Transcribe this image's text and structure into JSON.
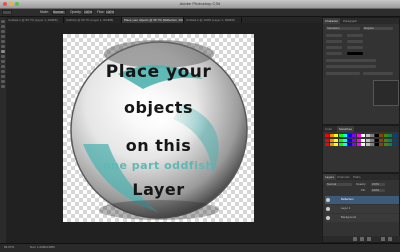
{
  "window": {
    "title": "Adobe Photoshop CS6"
  },
  "options_bar": {
    "tool": "Brush",
    "mode_label": "Mode:",
    "mode_value": "Normal",
    "opacity_label": "Opacity:",
    "opacity_value": "100%",
    "flow_label": "Flow:",
    "flow_value": "100%"
  },
  "tabs": [
    {
      "label": "Untitled-1 @ 66.7% (Layer 1, RGB/8)"
    },
    {
      "label": "SoftClip @ 66.7% (Layer 1, RGB/8)"
    },
    {
      "label": "Place your objects @ 66.7% (Reflection, RGB/8)"
    },
    {
      "label": "Untitled-2 @ 100% (Layer 1, RGB/8)"
    }
  ],
  "canvas_text": {
    "line1": "Place your",
    "line2": "objects",
    "line3": "on this",
    "line4": "one part oddfish",
    "line5": "Layer"
  },
  "panels": {
    "character": {
      "tabs": [
        "Character",
        "Paragraph"
      ],
      "font": "Sansation",
      "style": "Regular"
    },
    "swatches": {
      "tabs": [
        "Color",
        "Swatches"
      ],
      "colors": [
        "#ff0000",
        "#ff8800",
        "#ffff00",
        "#00ff00",
        "#00ffff",
        "#0000ff",
        "#8800ff",
        "#ff00ff",
        "#ffffff",
        "#c0c0c0",
        "#808080",
        "#000000",
        "#884400",
        "#448800",
        "#008844",
        "#004488"
      ]
    },
    "layers": {
      "tabs": [
        "Layers",
        "Channels",
        "Paths"
      ],
      "blend": "Normal",
      "opacity_label": "Opacity:",
      "opacity_value": "100%",
      "fill_label": "Fill:",
      "fill_value": "100%",
      "items": [
        "Reflection",
        "Layer 1",
        "Background"
      ]
    }
  },
  "status": {
    "zoom": "66.67%",
    "doc_info": "Doc: 1.03M/4.68M"
  },
  "colors": {
    "teal": "#4fb3b0",
    "chrome_dark": "#1e1e1e"
  }
}
